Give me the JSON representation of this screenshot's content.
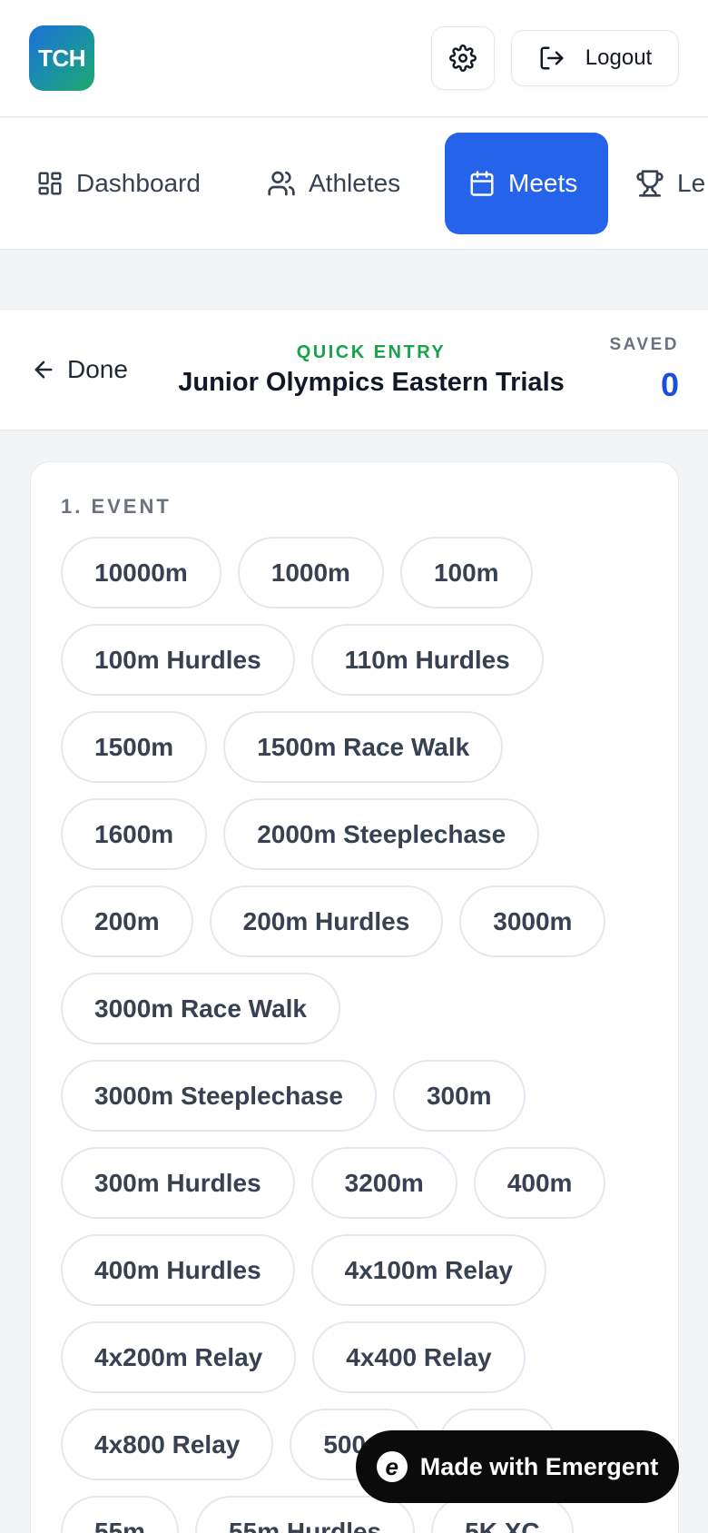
{
  "app": {
    "logo_text": "TCH"
  },
  "topbar": {
    "logout_label": "Logout"
  },
  "nav": {
    "items": [
      {
        "label": "Dashboard",
        "icon": "grid-icon",
        "active": false
      },
      {
        "label": "Athletes",
        "icon": "users-icon",
        "active": false
      },
      {
        "label": "Meets",
        "icon": "calendar-icon",
        "active": true
      },
      {
        "label": "Le",
        "icon": "trophy-icon",
        "active": false
      }
    ]
  },
  "header": {
    "back_label": "Done",
    "mode_label": "QUICK ENTRY",
    "meet_title": "Junior Olympics Eastern Trials",
    "saved_label": "SAVED",
    "saved_count": "0"
  },
  "event_section": {
    "label": "1. EVENT",
    "events": [
      "10000m",
      "1000m",
      "100m",
      "100m Hurdles",
      "110m Hurdles",
      "1500m",
      "1500m Race Walk",
      "1600m",
      "2000m Steeplechase",
      "200m",
      "200m Hurdles",
      "3000m",
      "3000m Race Walk",
      "3000m Steeplechase",
      "300m",
      "300m Hurdles",
      "3200m",
      "400m",
      "400m Hurdles",
      "4x100m Relay",
      "4x200m Relay",
      "4x400 Relay",
      "4x800 Relay",
      "500m",
      "55m",
      "55m",
      "55m Hurdles",
      "5K XC"
    ]
  },
  "badge": {
    "label": "Made with Emergent"
  },
  "colors": {
    "accent": "#2563eb",
    "quick_entry": "#16a34a",
    "saved_count": "#1d4ed8"
  }
}
